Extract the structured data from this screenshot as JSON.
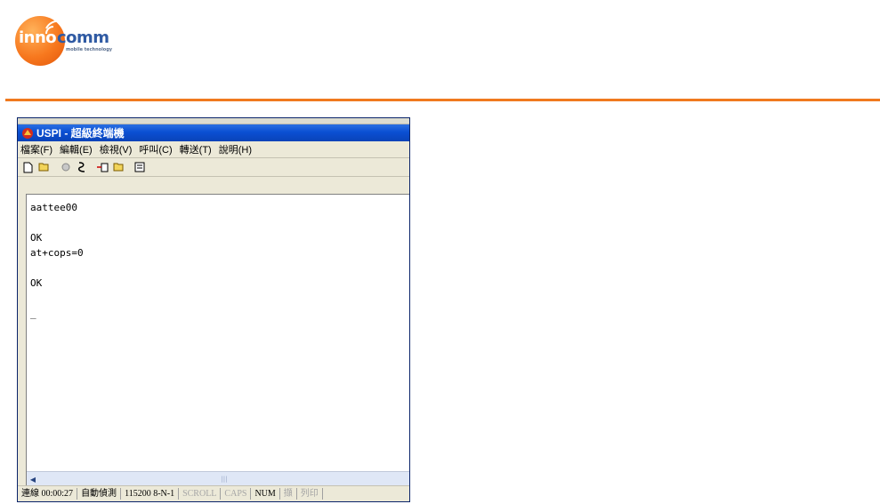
{
  "logo": {
    "part1": "inno",
    "part2": "comm",
    "tagline": "mobile technology"
  },
  "window": {
    "title": "USPI - 超級終端機",
    "menu": [
      "檔案(F)",
      "編輯(E)",
      "檢視(V)",
      "呼叫(C)",
      "轉送(T)",
      "說明(H)"
    ],
    "toolbar_icons": [
      "new-icon",
      "open-icon",
      "disconnect-icon",
      "connect-icon",
      "send-icon",
      "receive-icon",
      "properties-icon"
    ]
  },
  "terminal": {
    "lines": [
      "aattee00",
      "",
      "OK",
      "at+cops=0",
      "",
      "OK",
      "",
      "_"
    ]
  },
  "statusbar": {
    "connected": "連線 00:00:27",
    "detect": "自動偵測",
    "settings": "115200 8-N-1",
    "scroll": "SCROLL",
    "caps": "CAPS",
    "num": "NUM",
    "capture": "擷",
    "print": "列印"
  },
  "colors": {
    "accent": "#f07a1e",
    "brand_blue": "#2f5aa3",
    "titlebar": "#0a4fd3"
  }
}
